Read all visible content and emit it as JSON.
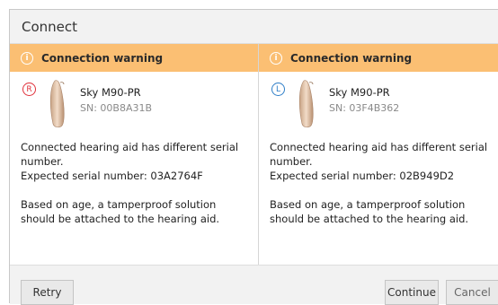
{
  "dialog": {
    "title": "Connect"
  },
  "columns": [
    {
      "warning": "Connection warning",
      "side_badge": "R",
      "side_color": "#e0303a",
      "device_model": "Sky M90-PR",
      "serial": "SN: 00B8A31B",
      "message_1": "Connected hearing aid has different serial number.",
      "message_2": "Expected serial number: 03A2764F",
      "message_3": "Based on age, a tamperproof solution should be attached to the hearing aid."
    },
    {
      "warning": "Connection warning",
      "side_badge": "L",
      "side_color": "#2e7ec8",
      "device_model": "Sky M90-PR",
      "serial": "SN: 03F4B362",
      "message_1": "Connected hearing aid has different serial number.",
      "message_2": "Expected serial number: 02B949D2",
      "message_3": "Based on age, a tamperproof solution should be attached to the hearing aid."
    }
  ],
  "footer": {
    "retry": "Retry",
    "continue": "Continue",
    "cancel": "Cancel"
  },
  "colors": {
    "warning_bar": "#fbbf73",
    "title_bar": "#f2f2f2"
  },
  "icons": {
    "warning": "info-circle-icon",
    "device": "hearing-aid-icon"
  }
}
